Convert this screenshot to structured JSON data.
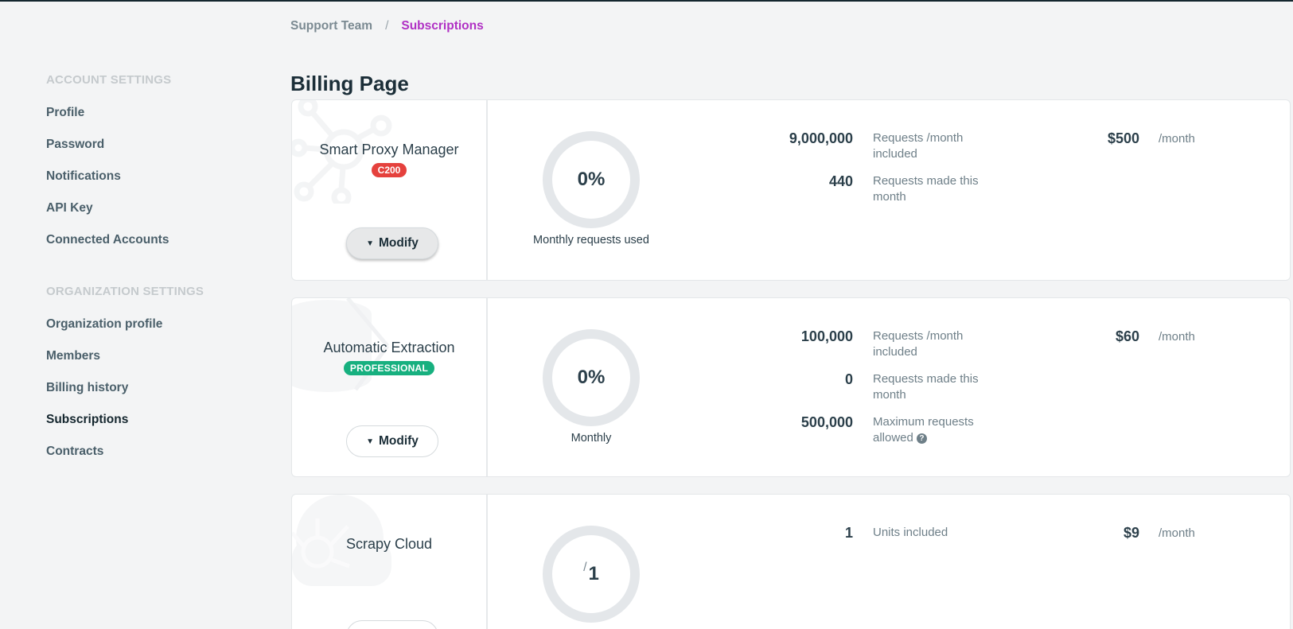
{
  "breadcrumb": {
    "parent": "Support Team",
    "separator": "/",
    "current": "Subscriptions"
  },
  "page": {
    "title": "Billing Page"
  },
  "sidebar": {
    "account_header": "ACCOUNT SETTINGS",
    "account_items": [
      "Profile",
      "Password",
      "Notifications",
      "API Key",
      "Connected Accounts"
    ],
    "org_header": "ORGANIZATION SETTINGS",
    "org_items": [
      "Organization profile",
      "Members",
      "Billing history",
      "Subscriptions",
      "Contracts"
    ],
    "active_item": "Subscriptions"
  },
  "subscriptions": [
    {
      "name": "Smart Proxy Manager",
      "badge": "C200",
      "badge_color": "#e5413d",
      "modify_label": "Modify",
      "gauge_value": "0%",
      "gauge_label": "Monthly requests used",
      "stats": [
        {
          "value": "9,000,000",
          "label": "Requests /month included"
        },
        {
          "value": "440",
          "label": "Requests made this month"
        }
      ],
      "price": "$500",
      "price_unit": "/month"
    },
    {
      "name": "Automatic Extraction",
      "badge": "PROFESSIONAL",
      "badge_color": "#17b07f",
      "modify_label": "Modify",
      "gauge_value": "0%",
      "gauge_label": "Monthly",
      "stats": [
        {
          "value": "100,000",
          "label": "Requests /month included"
        },
        {
          "value": "0",
          "label": "Requests made this month"
        },
        {
          "value": "500,000",
          "label": "Maximum requests allowed"
        }
      ],
      "price": "$60",
      "price_unit": "/month"
    },
    {
      "name": "Scrapy Cloud",
      "gauge_slash": "/",
      "gauge_value": "1",
      "stats": [
        {
          "value": "1",
          "label": "Units included"
        }
      ],
      "price": "$9",
      "price_unit": "/month"
    }
  ]
}
